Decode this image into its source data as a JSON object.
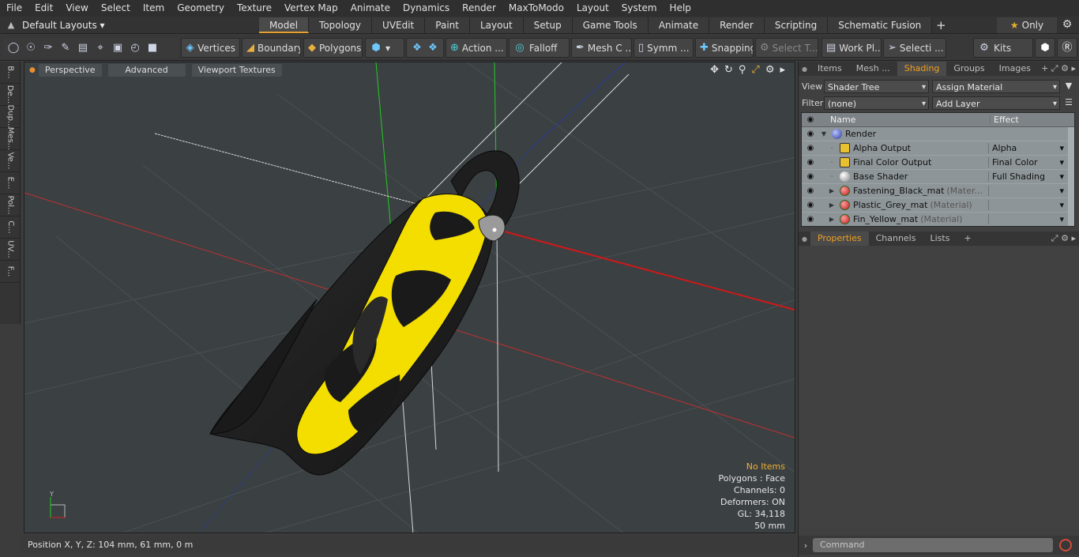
{
  "menubar": [
    "File",
    "Edit",
    "View",
    "Select",
    "Item",
    "Geometry",
    "Texture",
    "Vertex Map",
    "Animate",
    "Dynamics",
    "Render",
    "MaxToModo",
    "Layout",
    "System",
    "Help"
  ],
  "layoutbar": {
    "layout_select": "Default Layouts",
    "tabs": [
      "Model",
      "Topology",
      "UVEdit",
      "Paint",
      "Layout",
      "Setup",
      "Game Tools",
      "Animate",
      "Render",
      "Scripting",
      "Schematic Fusion"
    ],
    "active_tab": "Model",
    "only_label": "Only"
  },
  "toolbar": {
    "vertices": "Vertices",
    "boundary": "Boundary",
    "polygons": "Polygons",
    "action": "Action ...",
    "falloff": "Falloff",
    "mesh_c": "Mesh C ...",
    "symm": "Symm ...",
    "snapping": "Snapping",
    "select_t": "Select T...",
    "work_pl": "Work Pl...",
    "selecti": "Selecti ...",
    "kits": "Kits"
  },
  "lefttabs": [
    "B...",
    "De...",
    "Dup...",
    "Mes...",
    "Ve...",
    "E...",
    "Pol...",
    "C...",
    "UV...",
    "F..."
  ],
  "viewport": {
    "view_mode": "Perspective",
    "advanced": "Advanced",
    "viewport_textures": "Viewport Textures",
    "hud": {
      "no_items": "No Items",
      "polygons": "Polygons : Face",
      "channels": "Channels: 0",
      "deformers": "Deformers: ON",
      "gl": "GL: 34,118",
      "scale": "50 mm"
    }
  },
  "statusbar": {
    "position": "Position X, Y, Z:   104 mm, 61 mm, 0 m"
  },
  "rightpanel": {
    "tabs": [
      "Items",
      "Mesh ...",
      "Shading",
      "Groups",
      "Images"
    ],
    "active_tab": "Shading",
    "view_label": "View",
    "view_value": "Shader Tree",
    "assign_material": "Assign Material",
    "filter_label": "Filter",
    "filter_value": "(none)",
    "add_layer": "Add Layer",
    "tree_headers": {
      "name": "Name",
      "effect": "Effect"
    },
    "tree_rows": [
      {
        "name": "Render",
        "tag": "",
        "effect": "",
        "icon": "render",
        "indent": 0
      },
      {
        "name": "Alpha Output",
        "tag": "",
        "effect": "Alpha",
        "icon": "output",
        "indent": 1
      },
      {
        "name": "Final Color Output",
        "tag": "",
        "effect": "Final Color",
        "icon": "output",
        "indent": 1
      },
      {
        "name": "Base Shader",
        "tag": "",
        "effect": "Full Shading",
        "icon": "shader",
        "indent": 1
      },
      {
        "name": "Fastening_Black_mat",
        "tag": "(Mater...",
        "effect": "",
        "icon": "material",
        "indent": 1
      },
      {
        "name": "Plastic_Grey_mat",
        "tag": "(Material)",
        "effect": "",
        "icon": "material",
        "indent": 1
      },
      {
        "name": "Fin_Yellow_mat",
        "tag": "(Material)",
        "effect": "",
        "icon": "material",
        "indent": 1
      }
    ],
    "prop_tabs": [
      "Properties",
      "Channels",
      "Lists"
    ],
    "active_prop_tab": "Properties",
    "command_placeholder": "Command"
  },
  "colors": {
    "accent": "#f0a020",
    "fin_yellow": "#f5e000",
    "fin_black": "#1a1a1a",
    "grid_red": "#d01818",
    "grid_green": "#22cc22",
    "grid_blue": "#2233aa"
  }
}
